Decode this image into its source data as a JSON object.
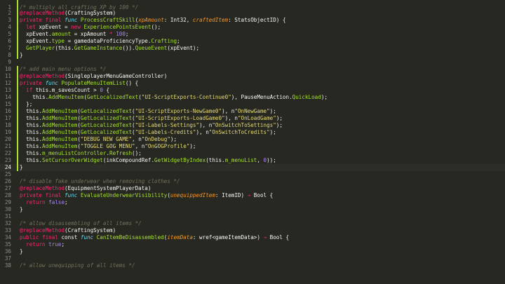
{
  "editor": {
    "colors": {
      "background": "#272822",
      "line_number": "#8f908a",
      "modified_marker": "#a6e22e",
      "comment": "#75715e",
      "decorator": "#f92672",
      "keyword": "#f92672",
      "storage": "#66d9ef",
      "function": "#a6e22e",
      "type": "#66d9ef",
      "param": "#fd971f",
      "string": "#e6db74",
      "number": "#ae81ff",
      "constant": "#ae81ff",
      "default": "#f8f8f2"
    },
    "lines": [
      {
        "n": "1",
        "m": true,
        "t": [
          [
            "c",
            "/* multiply all crafting XP by 100 */"
          ]
        ]
      },
      {
        "n": "2",
        "m": true,
        "t": [
          [
            "k",
            "@replaceMethod"
          ],
          [
            "d",
            "(CraftingSystem)"
          ]
        ]
      },
      {
        "n": "3",
        "m": true,
        "t": [
          [
            "k",
            "private final "
          ],
          [
            "s",
            "func "
          ],
          [
            "f",
            "ProcessCraftSkill"
          ],
          [
            "d",
            "("
          ],
          [
            "p",
            "xpAmount"
          ],
          [
            "d",
            ": Int32, "
          ],
          [
            "p",
            "craftedItem"
          ],
          [
            "d",
            ": StatsObjectID) {"
          ]
        ]
      },
      {
        "n": "4",
        "m": true,
        "t": [
          [
            "d",
            "  "
          ],
          [
            "k",
            "let "
          ],
          [
            "d",
            "xpEvent = "
          ],
          [
            "k",
            "new "
          ],
          [
            "f",
            "ExperiencePointsEvent"
          ],
          [
            "d",
            "();"
          ]
        ]
      },
      {
        "n": "5",
        "m": true,
        "t": [
          [
            "d",
            "  xpEvent."
          ],
          [
            "f",
            "amount"
          ],
          [
            "d",
            " = xpAmount "
          ],
          [
            "k",
            "* "
          ],
          [
            "n",
            "100"
          ],
          [
            "d",
            ";"
          ]
        ]
      },
      {
        "n": "6",
        "m": true,
        "t": [
          [
            "d",
            "  xpEvent."
          ],
          [
            "f",
            "type"
          ],
          [
            "d",
            " = gamedataProficiencyType."
          ],
          [
            "f",
            "Crafting"
          ],
          [
            "d",
            ";"
          ]
        ]
      },
      {
        "n": "7",
        "m": true,
        "t": [
          [
            "d",
            "  "
          ],
          [
            "f",
            "GetPlayer"
          ],
          [
            "d",
            "(this."
          ],
          [
            "f",
            "GetGameInstance"
          ],
          [
            "d",
            "())."
          ],
          [
            "f",
            "QueueEvent"
          ],
          [
            "d",
            "(xpEvent);"
          ]
        ]
      },
      {
        "n": "8",
        "m": true,
        "t": [
          [
            "d",
            "}"
          ]
        ]
      },
      {
        "n": "9",
        "m": false,
        "t": []
      },
      {
        "n": "10",
        "m": true,
        "t": [
          [
            "c",
            "/* add main menu options */"
          ]
        ]
      },
      {
        "n": "11",
        "m": true,
        "t": [
          [
            "k",
            "@replaceMethod"
          ],
          [
            "d",
            "(SingleplayerMenuGameController)"
          ]
        ]
      },
      {
        "n": "12",
        "m": true,
        "t": [
          [
            "k",
            "private "
          ],
          [
            "s",
            "func "
          ],
          [
            "f",
            "PopulateMenuItemList"
          ],
          [
            "d",
            "() {"
          ]
        ]
      },
      {
        "n": "13",
        "m": true,
        "t": [
          [
            "d",
            "  "
          ],
          [
            "k",
            "if "
          ],
          [
            "d",
            "this.m_savesCount > "
          ],
          [
            "n",
            "0"
          ],
          [
            "d",
            " {"
          ]
        ]
      },
      {
        "n": "14",
        "m": true,
        "t": [
          [
            "d",
            "    this."
          ],
          [
            "f",
            "AddMenuItem"
          ],
          [
            "d",
            "("
          ],
          [
            "f",
            "GetLocalizedText"
          ],
          [
            "d",
            "("
          ],
          [
            "g",
            "\"UI-ScriptExports-Continue0\""
          ],
          [
            "d",
            "), PauseMenuAction."
          ],
          [
            "f",
            "QuickLoad"
          ],
          [
            "d",
            ");"
          ]
        ]
      },
      {
        "n": "15",
        "m": true,
        "t": [
          [
            "d",
            "  };"
          ]
        ]
      },
      {
        "n": "16",
        "m": true,
        "t": [
          [
            "d",
            "  this."
          ],
          [
            "f",
            "AddMenuItem"
          ],
          [
            "d",
            "("
          ],
          [
            "f",
            "GetLocalizedText"
          ],
          [
            "d",
            "("
          ],
          [
            "g",
            "\"UI-ScriptExports-NewGame0\""
          ],
          [
            "d",
            "), n"
          ],
          [
            "g",
            "\"OnNewGame\""
          ],
          [
            "d",
            ");"
          ]
        ]
      },
      {
        "n": "17",
        "m": true,
        "t": [
          [
            "d",
            "  this."
          ],
          [
            "f",
            "AddMenuItem"
          ],
          [
            "d",
            "("
          ],
          [
            "f",
            "GetLocalizedText"
          ],
          [
            "d",
            "("
          ],
          [
            "g",
            "\"UI-ScriptExports-LoadGame0\""
          ],
          [
            "d",
            "), n"
          ],
          [
            "g",
            "\"OnLoadGame\""
          ],
          [
            "d",
            ");"
          ]
        ]
      },
      {
        "n": "18",
        "m": true,
        "t": [
          [
            "d",
            "  this."
          ],
          [
            "f",
            "AddMenuItem"
          ],
          [
            "d",
            "("
          ],
          [
            "f",
            "GetLocalizedText"
          ],
          [
            "d",
            "("
          ],
          [
            "g",
            "\"UI-Labels-Settings\""
          ],
          [
            "d",
            "), n"
          ],
          [
            "g",
            "\"OnSwitchToSettings\""
          ],
          [
            "d",
            ");"
          ]
        ]
      },
      {
        "n": "19",
        "m": true,
        "t": [
          [
            "d",
            "  this."
          ],
          [
            "f",
            "AddMenuItem"
          ],
          [
            "d",
            "("
          ],
          [
            "f",
            "GetLocalizedText"
          ],
          [
            "d",
            "("
          ],
          [
            "g",
            "\"UI-Labels-Credits\""
          ],
          [
            "d",
            "), n"
          ],
          [
            "g",
            "\"OnSwitchToCredits\""
          ],
          [
            "d",
            ");"
          ]
        ]
      },
      {
        "n": "20",
        "m": true,
        "t": [
          [
            "d",
            "  this."
          ],
          [
            "f",
            "AddMenuItem"
          ],
          [
            "d",
            "("
          ],
          [
            "g",
            "\"DEBUG NEW GAME\""
          ],
          [
            "d",
            ", n"
          ],
          [
            "g",
            "\"OnDebug\""
          ],
          [
            "d",
            ");"
          ]
        ]
      },
      {
        "n": "21",
        "m": true,
        "t": [
          [
            "d",
            "  this."
          ],
          [
            "f",
            "AddMenuItem"
          ],
          [
            "d",
            "("
          ],
          [
            "g",
            "\"TOGGLE GOG MENU\""
          ],
          [
            "d",
            ", n"
          ],
          [
            "g",
            "\"OnGOGProfile\""
          ],
          [
            "d",
            ");"
          ]
        ]
      },
      {
        "n": "22",
        "m": true,
        "t": [
          [
            "d",
            "  this."
          ],
          [
            "f",
            "m_menuListController"
          ],
          [
            "d",
            "."
          ],
          [
            "f",
            "Refresh"
          ],
          [
            "d",
            "();"
          ]
        ]
      },
      {
        "n": "23",
        "m": true,
        "t": [
          [
            "d",
            "  this."
          ],
          [
            "f",
            "SetCursorOverWidget"
          ],
          [
            "d",
            "(inkCompoundRef."
          ],
          [
            "f",
            "GetWidgetByIndex"
          ],
          [
            "d",
            "(this."
          ],
          [
            "f",
            "m_menuList"
          ],
          [
            "d",
            ", "
          ],
          [
            "n",
            "0"
          ],
          [
            "d",
            "));"
          ]
        ]
      },
      {
        "n": "24",
        "m": true,
        "hl": true,
        "t": [
          [
            "d",
            "}"
          ]
        ]
      },
      {
        "n": "25",
        "m": false,
        "t": []
      },
      {
        "n": "26",
        "m": false,
        "t": [
          [
            "c",
            "/* disable fake underwear when removing clothes */"
          ]
        ]
      },
      {
        "n": "27",
        "m": false,
        "t": [
          [
            "k",
            "@replaceMethod"
          ],
          [
            "d",
            "(EquipmentSystemPlayerData)"
          ]
        ]
      },
      {
        "n": "28",
        "m": false,
        "t": [
          [
            "k",
            "private final "
          ],
          [
            "s",
            "func "
          ],
          [
            "f",
            "EvaluateUnderwearVisibility"
          ],
          [
            "d",
            "("
          ],
          [
            "p",
            "unequippedItem"
          ],
          [
            "d",
            ": ItemID) "
          ],
          [
            "k",
            "→ "
          ],
          [
            "d",
            "Bool {"
          ]
        ]
      },
      {
        "n": "29",
        "m": false,
        "t": [
          [
            "d",
            "  "
          ],
          [
            "k",
            "return "
          ],
          [
            "n",
            "false"
          ],
          [
            "d",
            ";"
          ]
        ]
      },
      {
        "n": "30",
        "m": false,
        "t": [
          [
            "d",
            "}"
          ]
        ]
      },
      {
        "n": "31",
        "m": false,
        "t": []
      },
      {
        "n": "32",
        "m": false,
        "t": [
          [
            "c",
            "/* allow disassembling of all items */"
          ]
        ]
      },
      {
        "n": "33",
        "m": false,
        "t": [
          [
            "k",
            "@replaceMethod"
          ],
          [
            "d",
            "(CraftingSystem)"
          ]
        ]
      },
      {
        "n": "34",
        "m": false,
        "t": [
          [
            "k",
            "public final "
          ],
          [
            "d",
            "const "
          ],
          [
            "s",
            "func "
          ],
          [
            "f",
            "CanItemBeDisassembled"
          ],
          [
            "d",
            "("
          ],
          [
            "p",
            "itemData"
          ],
          [
            "d",
            ": wref<gameItemData>) "
          ],
          [
            "k",
            "→ "
          ],
          [
            "d",
            "Bool {"
          ]
        ]
      },
      {
        "n": "35",
        "m": false,
        "t": [
          [
            "d",
            "  "
          ],
          [
            "k",
            "return "
          ],
          [
            "n",
            "true"
          ],
          [
            "d",
            ";"
          ]
        ]
      },
      {
        "n": "36",
        "m": false,
        "t": [
          [
            "d",
            "}"
          ]
        ]
      },
      {
        "n": "37",
        "m": false,
        "t": []
      },
      {
        "n": "38",
        "m": false,
        "t": [
          [
            "c",
            "/* allow unequipping of all items */"
          ]
        ]
      }
    ]
  }
}
